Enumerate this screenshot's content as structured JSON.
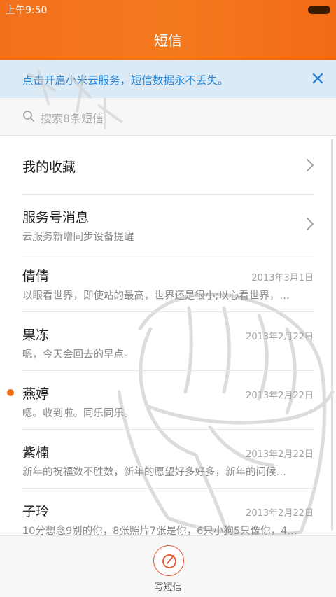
{
  "status_bar": {
    "time": "上午9:50"
  },
  "header": {
    "title": "短信"
  },
  "banner": {
    "text": "点击开启小米云服务，短信数据永不丢失。"
  },
  "search": {
    "placeholder": "搜索8条短信"
  },
  "rows": [
    {
      "title": "我的收藏",
      "subtitle": "",
      "date": ""
    },
    {
      "title": "服务号消息",
      "subtitle": "云服务新增同步设备提醒",
      "date": ""
    },
    {
      "title": "倩倩",
      "subtitle": "以眼看世界，即使站的最高，世界还是很小;以心看世界，…",
      "date": "2013年3月1日"
    },
    {
      "title": "果冻",
      "subtitle": "嗯，今天会回去的早点。",
      "date": "2013年2月22日"
    },
    {
      "title": "燕婷",
      "subtitle": "嗯。收到啦。同乐同乐。",
      "date": "2013年2月22日",
      "unread": true
    },
    {
      "title": "紫楠",
      "subtitle": "新年的祝福数不胜数，新年的愿望好多好多，新年的问候…",
      "date": "2013年2月22日"
    },
    {
      "title": "子玲",
      "subtitle": "10分想念9别的你，8张照片7张是你，6只小狗5只像你，4…",
      "date": "2013年2月22日"
    }
  ],
  "bottom_bar": {
    "compose_label": "写短信"
  },
  "colors": {
    "accent": "#f2701c",
    "banner_text": "#2a86d8",
    "unread": "#f06a16",
    "compose": "#e9532a"
  }
}
